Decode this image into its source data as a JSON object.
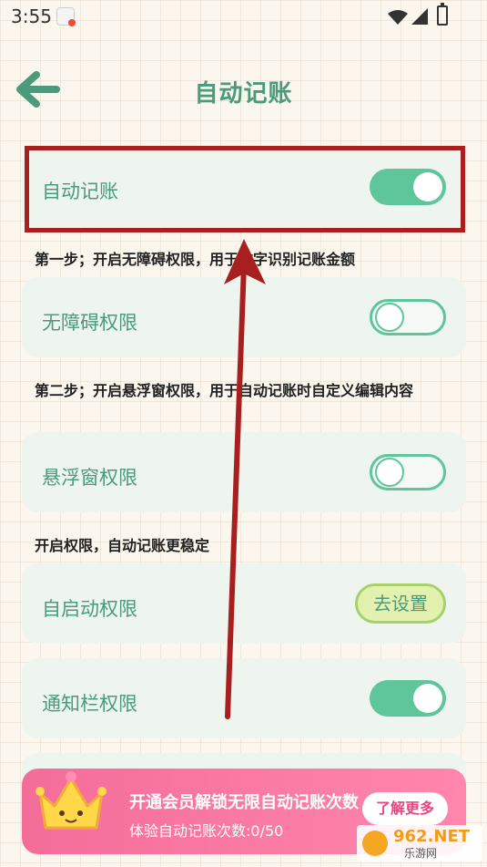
{
  "status_bar": {
    "time": "3:55"
  },
  "header": {
    "title": "自动记账",
    "back_icon": "back-arrow-icon"
  },
  "auto_record": {
    "label": "自动记账",
    "enabled": true
  },
  "step1": {
    "text": "第一步；开启无障碍权限，用于文字识别记账金额"
  },
  "accessibility": {
    "label": "无障碍权限",
    "enabled": false
  },
  "step2": {
    "text": "第二步；开启悬浮窗权限，用于自动记账时自定义编辑内容"
  },
  "floating_window": {
    "label": "悬浮窗权限",
    "enabled": false
  },
  "step3": {
    "text": "开启权限，自动记账更稳定"
  },
  "autostart": {
    "label": "自启动权限",
    "button_label": "去设置"
  },
  "notification": {
    "label": "通知栏权限",
    "enabled": true
  },
  "promo": {
    "title": "开通会员解锁无限自动记账次数",
    "subtitle": "体验自动记账次数:0/50",
    "button_label": "了解更多"
  },
  "watermark": {
    "brand": "962.NET",
    "sub": "乐游网"
  },
  "colors": {
    "accent": "#4a9a7c",
    "toggle_on": "#5fc59a",
    "highlight": "#a81f1f",
    "promo": "#f46d9a"
  }
}
